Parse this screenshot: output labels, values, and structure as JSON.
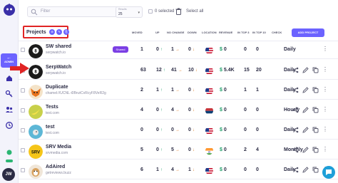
{
  "toolbar": {
    "search_placeholder": "Filter",
    "results_label": "Results",
    "results_value": "25",
    "selected_count": "0",
    "selected_label": "selected",
    "select_all_label": "Select all"
  },
  "sidebar": {
    "admin_label": "ADMIN",
    "avatar_initials": "JW"
  },
  "header": {
    "title": "Projects",
    "columns": [
      "MOVED",
      "UP",
      "NO CHANGE",
      "DOWN",
      "LOCATION",
      "REVENUE",
      "IN TOP 3",
      "IN TOP 10",
      "CHECK"
    ],
    "add_button": "ADD PROJECT"
  },
  "colors": {
    "accent": "#6c63ff",
    "up": "#22a06b",
    "down": "#e0802b",
    "highlight": "#e02424"
  },
  "projects": [
    {
      "name": "SW shared",
      "url": "serpwatch.io",
      "tag": "Shared",
      "moved": "1",
      "up": "0",
      "nochange": "1",
      "down": "0",
      "flag": "us",
      "revenue": "0",
      "top3": "0",
      "top10": "0",
      "check": "Daily",
      "actions": false,
      "icon": "8-ball"
    },
    {
      "name": "SerpWatch",
      "url": "serpwatch.io",
      "tag": "",
      "moved": "63",
      "up": "12",
      "nochange": "41",
      "down": "10",
      "flag": "us",
      "revenue": "5.4K",
      "top3": "15",
      "top10": "20",
      "check": "Daily",
      "actions": true,
      "icon": "8-ball"
    },
    {
      "name": "Duplicate",
      "url": "chamel://UCNL-i0BnziCvRcyF8VeR2g",
      "tag": "",
      "moved": "2",
      "up": "1",
      "nochange": "1",
      "down": "0",
      "flag": "us",
      "revenue": "0",
      "top3": "1",
      "top10": "1",
      "check": "Daily",
      "actions": true,
      "icon": "fox"
    },
    {
      "name": "Tests",
      "url": "test.com",
      "tag": "",
      "moved": "4",
      "up": "0",
      "nochange": "4",
      "down": "0",
      "flag": "rs",
      "revenue": "0",
      "top3": "0",
      "top10": "0",
      "check": "Hourly",
      "actions": true,
      "icon": "banana"
    },
    {
      "name": "test",
      "url": "test.com",
      "tag": "",
      "moved": "0",
      "up": "0",
      "nochange": "0",
      "down": "0",
      "flag": "us",
      "revenue": "0",
      "top3": "0",
      "top10": "0",
      "check": "Daily",
      "actions": true,
      "icon": "bird"
    },
    {
      "name": "SRV Media",
      "url": "srvmedia.com",
      "tag": "",
      "moved": "5",
      "up": "0",
      "nochange": "5",
      "down": "0",
      "flag": "in",
      "revenue": "0",
      "top3": "2",
      "top10": "4",
      "check": "Monthly",
      "actions": true,
      "icon": "srv"
    },
    {
      "name": "AdAired",
      "url": "getreviews.buzz",
      "tag": "",
      "moved": "6",
      "up": "1",
      "nochange": "4",
      "down": "1",
      "flag": "us",
      "revenue": "0",
      "top3": "0",
      "top10": "0",
      "check": "Daily",
      "actions": true,
      "icon": "dog"
    }
  ]
}
